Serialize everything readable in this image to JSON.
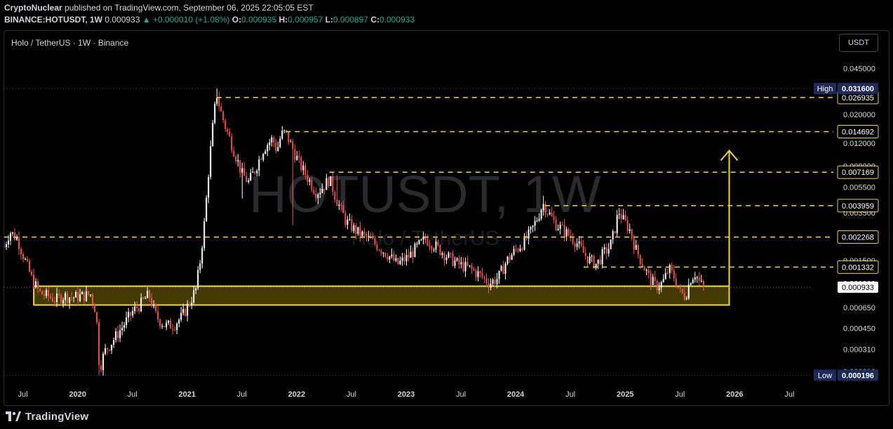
{
  "header": {
    "publisher": "CryptoNuclear",
    "published_text": "published on TradingView.com, September 06, 2025 22:05:05 EST",
    "symbol": "BINANCE:HOTUSDT, 1W",
    "last": "0.000933",
    "arrow": "▲",
    "change": "+0.000010 (+1.08%)",
    "o_label": "O:",
    "o_value": "0.000935",
    "h_label": "H:",
    "h_value": "0.000957",
    "l_label": "L:",
    "l_value": "0.000897",
    "c_label": "C:",
    "c_value": "0.000933"
  },
  "legend": {
    "title": "Holo / TetherUS · 1W · Binance"
  },
  "currency": "USDT",
  "watermark": {
    "symbol": "HOTUSDT, 1W",
    "name": "Holo / TetherUS"
  },
  "footer": {
    "brand": "TradingView",
    "logo_icon": "tradingview-logo-icon"
  },
  "colors": {
    "bg": "#000000",
    "up": "#ffffff",
    "down": "#ef5350",
    "level_line": "#f5d442",
    "zone_fill": "#7a6a06",
    "zone_border": "#f5d442",
    "axis_text": "#d1d4dc",
    "badge_dark": "#131722",
    "badge_blue": "#1e2a5a"
  },
  "chart_data": {
    "type": "candlestick",
    "scale": "log",
    "ylim": [
      0.000185,
      0.052
    ],
    "y_ticks": [
      "0.045000",
      "0.030000",
      "0.020000",
      "0.012000",
      "0.008000",
      "0.005500",
      "0.003500",
      "0.002300",
      "0.001500",
      "0.001000",
      "0.000650",
      "0.000450",
      "0.000310",
      "0.000210"
    ],
    "x_labels": [
      {
        "label": "Jul",
        "t": 2019.5
      },
      {
        "label": "2020",
        "t": 2020.0
      },
      {
        "label": "Jul",
        "t": 2020.5
      },
      {
        "label": "2021",
        "t": 2021.0
      },
      {
        "label": "Jul",
        "t": 2021.5
      },
      {
        "label": "2022",
        "t": 2022.0
      },
      {
        "label": "Jul",
        "t": 2022.5
      },
      {
        "label": "2023",
        "t": 2023.0
      },
      {
        "label": "Jul",
        "t": 2023.5
      },
      {
        "label": "2024",
        "t": 2024.0
      },
      {
        "label": "Jul",
        "t": 2024.5
      },
      {
        "label": "2025",
        "t": 2025.0
      },
      {
        "label": "Jul",
        "t": 2025.5
      },
      {
        "label": "2026",
        "t": 2026.0
      },
      {
        "label": "Jul",
        "t": 2026.5
      }
    ],
    "high": {
      "label": "High",
      "value": "0.031600"
    },
    "low": {
      "label": "Low",
      "value": "0.000196"
    },
    "last_price": "0.000933",
    "levels": [
      "0.026935",
      "0.014692",
      "0.007169",
      "0.003959",
      "0.002268",
      "0.001332"
    ],
    "support_zone": {
      "low": 0.00068,
      "high": 0.00095,
      "t_start": 2019.6,
      "t_end": 2025.95
    },
    "target_arrow": {
      "t": 2025.95,
      "from": 0.00095,
      "to": 0.0105
    },
    "price_path": [
      [
        2019.33,
        0.0019
      ],
      [
        2019.38,
        0.0025
      ],
      [
        2019.45,
        0.0022
      ],
      [
        2019.52,
        0.0015
      ],
      [
        2019.58,
        0.0011
      ],
      [
        2019.65,
        0.00085
      ],
      [
        2019.72,
        0.0008
      ],
      [
        2019.8,
        0.00075
      ],
      [
        2019.88,
        0.0008
      ],
      [
        2019.95,
        0.00078
      ],
      [
        2020.05,
        0.0008
      ],
      [
        2020.12,
        0.00082
      ],
      [
        2020.17,
        0.0006
      ],
      [
        2020.2,
        0.00022
      ],
      [
        2020.25,
        0.0003
      ],
      [
        2020.32,
        0.00036
      ],
      [
        2020.4,
        0.00045
      ],
      [
        2020.5,
        0.0006
      ],
      [
        2020.58,
        0.0007
      ],
      [
        2020.65,
        0.00082
      ],
      [
        2020.72,
        0.00055
      ],
      [
        2020.8,
        0.00047
      ],
      [
        2020.88,
        0.00048
      ],
      [
        2020.95,
        0.00055
      ],
      [
        2021.02,
        0.0007
      ],
      [
        2021.08,
        0.0009
      ],
      [
        2021.12,
        0.0015
      ],
      [
        2021.16,
        0.003
      ],
      [
        2021.2,
        0.008
      ],
      [
        2021.24,
        0.018
      ],
      [
        2021.27,
        0.029
      ],
      [
        2021.3,
        0.022
      ],
      [
        2021.35,
        0.016
      ],
      [
        2021.42,
        0.011
      ],
      [
        2021.5,
        0.007
      ],
      [
        2021.56,
        0.006
      ],
      [
        2021.62,
        0.0075
      ],
      [
        2021.7,
        0.011
      ],
      [
        2021.78,
        0.013
      ],
      [
        2021.82,
        0.0105
      ],
      [
        2021.86,
        0.014
      ],
      [
        2021.9,
        0.0145
      ],
      [
        2021.96,
        0.011
      ],
      [
        2022.02,
        0.0085
      ],
      [
        2022.1,
        0.0065
      ],
      [
        2022.18,
        0.005
      ],
      [
        2022.24,
        0.0055
      ],
      [
        2022.3,
        0.0064
      ],
      [
        2022.36,
        0.0045
      ],
      [
        2022.45,
        0.003
      ],
      [
        2022.55,
        0.0025
      ],
      [
        2022.62,
        0.0023
      ],
      [
        2022.72,
        0.002
      ],
      [
        2022.82,
        0.0017
      ],
      [
        2022.92,
        0.0014
      ],
      [
        2023.02,
        0.0016
      ],
      [
        2023.1,
        0.0019
      ],
      [
        2023.18,
        0.0022
      ],
      [
        2023.28,
        0.0019
      ],
      [
        2023.38,
        0.0016
      ],
      [
        2023.48,
        0.0014
      ],
      [
        2023.58,
        0.0013
      ],
      [
        2023.68,
        0.00115
      ],
      [
        2023.76,
        0.001
      ],
      [
        2023.84,
        0.0011
      ],
      [
        2023.92,
        0.0015
      ],
      [
        2024.0,
        0.0018
      ],
      [
        2024.08,
        0.0021
      ],
      [
        2024.14,
        0.0025
      ],
      [
        2024.2,
        0.0032
      ],
      [
        2024.25,
        0.0041
      ],
      [
        2024.3,
        0.0035
      ],
      [
        2024.36,
        0.0029
      ],
      [
        2024.45,
        0.0025
      ],
      [
        2024.55,
        0.0021
      ],
      [
        2024.62,
        0.0017
      ],
      [
        2024.68,
        0.0015
      ],
      [
        2024.74,
        0.0014
      ],
      [
        2024.8,
        0.0017
      ],
      [
        2024.86,
        0.0019
      ],
      [
        2024.9,
        0.0025
      ],
      [
        2024.94,
        0.0036
      ],
      [
        2024.98,
        0.0031
      ],
      [
        2025.04,
        0.0026
      ],
      [
        2025.1,
        0.0018
      ],
      [
        2025.16,
        0.0014
      ],
      [
        2025.22,
        0.0011
      ],
      [
        2025.28,
        0.00095
      ],
      [
        2025.34,
        0.001
      ],
      [
        2025.4,
        0.0013
      ],
      [
        2025.45,
        0.0011
      ],
      [
        2025.5,
        0.00085
      ],
      [
        2025.55,
        0.0008
      ],
      [
        2025.6,
        0.0011
      ],
      [
        2025.64,
        0.0012
      ],
      [
        2025.68,
        0.001
      ],
      [
        2025.72,
        0.00093
      ]
    ],
    "wicks": [
      [
        2020.2,
        0.000196
      ],
      [
        2021.27,
        0.0316
      ],
      [
        2021.86,
        0.0162
      ],
      [
        2024.25,
        0.0047
      ],
      [
        2024.94,
        0.0038
      ],
      [
        2022.36,
        0.0068
      ],
      [
        2021.5,
        0.0045
      ],
      [
        2021.96,
        0.0028
      ]
    ]
  }
}
